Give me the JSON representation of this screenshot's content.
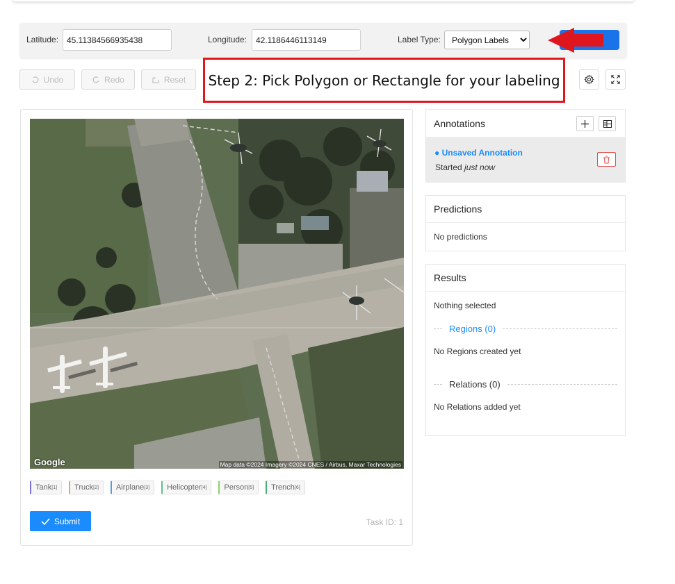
{
  "coords": {
    "latitude_label": "Latitude:",
    "latitude_value": "45.11384566935438",
    "longitude_label": "Longitude:",
    "longitude_value": "42.1186446113149",
    "label_type_label": "Label Type:",
    "label_type_value": "Polygon Labels"
  },
  "toolbar": {
    "undo": "Undo",
    "redo": "Redo",
    "reset": "Reset"
  },
  "callout": "Step 2: Pick Polygon or Rectangle for your labeling",
  "map": {
    "logo": "Google",
    "credit": "Map data ©2024 Imagery ©2024 CNES / Airbus, Maxar Technologies"
  },
  "labels": [
    {
      "name": "Tank",
      "key": "[1]",
      "color": "#7b6fd6"
    },
    {
      "name": "Truck",
      "key": "[2]",
      "color": "#c9b458"
    },
    {
      "name": "Airplane",
      "key": "[3]",
      "color": "#5b9ad6"
    },
    {
      "name": "Helicopter",
      "key": "[4]",
      "color": "#5fbf8f"
    },
    {
      "name": "Person",
      "key": "[5]",
      "color": "#8fce6a"
    },
    {
      "name": "Trench",
      "key": "[6]",
      "color": "#4aab7a"
    }
  ],
  "submit_label": "Submit",
  "task_id": "Task ID: 1",
  "annotations": {
    "title": "Annotations",
    "item_title": "Unsaved Annotation",
    "item_started": "Started",
    "item_time": "just now"
  },
  "predictions": {
    "title": "Predictions",
    "empty": "No predictions"
  },
  "results": {
    "title": "Results",
    "nothing": "Nothing selected",
    "regions_title": "Regions (0)",
    "regions_empty": "No Regions created yet",
    "relations_title": "Relations (0)",
    "relations_empty": "No Relations added yet"
  },
  "colors": {
    "accent": "#1a8cff",
    "callout_border": "#e0161f",
    "arrow": "#e0161f"
  }
}
